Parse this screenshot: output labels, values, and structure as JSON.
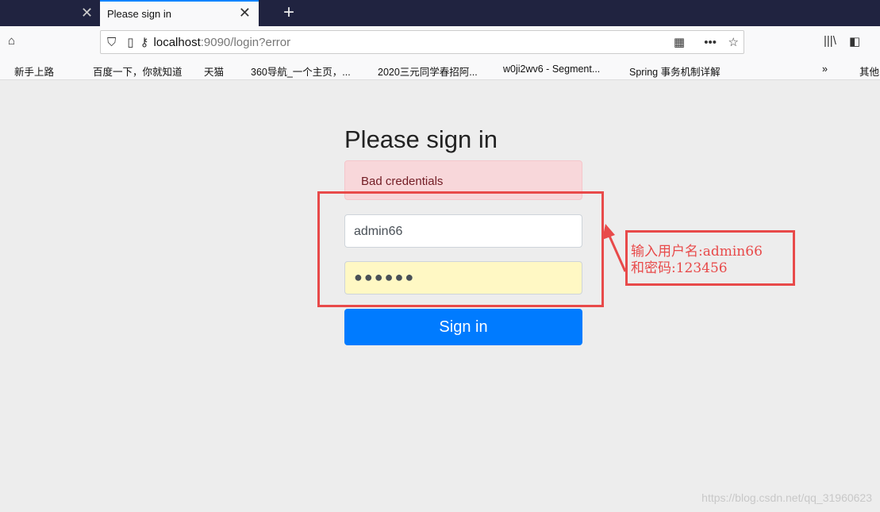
{
  "browser": {
    "tab_title": "Please sign in",
    "url_host": "localhost",
    "url_rest": ":9090/login?error",
    "bookmarks": [
      "新手上路",
      "百度一下，你就知道",
      "天猫",
      "360导航_一个主页，...",
      "2020三元同学春招阿...",
      "w0ji2wv6 - Segment...",
      "Spring 事务机制详解",
      "其他书签"
    ]
  },
  "page": {
    "heading": "Please sign in",
    "error": "Bad credentials",
    "username": "admin66",
    "password_mask": "●●●●●●",
    "submit": "Sign in"
  },
  "annotation": {
    "line1": "输入用户名:admin66",
    "line2": "和密码:123456",
    "color": "#e84a4a"
  },
  "watermark": "https://blog.csdn.net/qq_31960623"
}
